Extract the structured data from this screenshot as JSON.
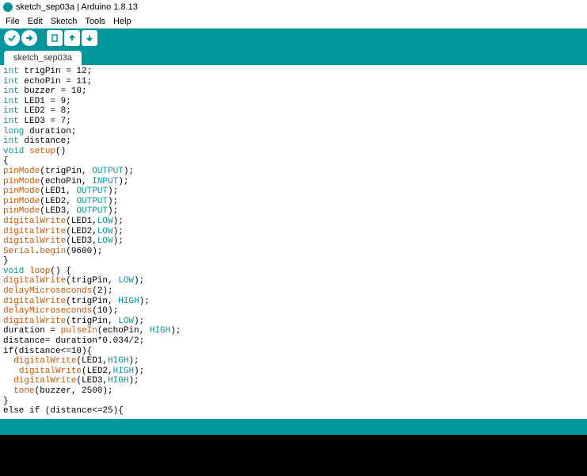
{
  "titlebar": {
    "text": "sketch_sep03a | Arduino 1.8.13"
  },
  "menubar": {
    "items": [
      "File",
      "Edit",
      "Sketch",
      "Tools",
      "Help"
    ]
  },
  "toolbar": {
    "verify": "✓",
    "upload": "→",
    "new": "🗋",
    "open": "↓",
    "save": "↑"
  },
  "tab": {
    "name": "sketch_sep03a"
  },
  "code": {
    "lines": [
      [
        [
          "kw-type",
          "int"
        ],
        [
          "",
          " trigPin = 12;"
        ]
      ],
      [
        [
          "kw-type",
          "int"
        ],
        [
          "",
          " echoPin = 11;"
        ]
      ],
      [
        [
          "kw-type",
          "int"
        ],
        [
          "",
          " buzzer = 10;"
        ]
      ],
      [
        [
          "kw-type",
          "int"
        ],
        [
          "",
          " LED1 = 9;"
        ]
      ],
      [
        [
          "kw-type",
          "int"
        ],
        [
          "",
          " LED2 = 8;"
        ]
      ],
      [
        [
          "kw-type",
          "int"
        ],
        [
          "",
          " LED3 = 7;"
        ]
      ],
      [
        [
          "kw-long",
          "long"
        ],
        [
          "",
          " duration;"
        ]
      ],
      [
        [
          "kw-type",
          "int"
        ],
        [
          "",
          " distance;"
        ]
      ],
      [
        [
          "kw-void",
          "void"
        ],
        [
          "",
          " "
        ],
        [
          "fn",
          "setup"
        ],
        [
          "",
          "()"
        ]
      ],
      [
        [
          "",
          "{"
        ]
      ],
      [
        [
          "fn",
          "pinMode"
        ],
        [
          "",
          "(trigPin, "
        ],
        [
          "const",
          "OUTPUT"
        ],
        [
          "",
          ");"
        ]
      ],
      [
        [
          "fn",
          "pinMode"
        ],
        [
          "",
          "(echoPin, "
        ],
        [
          "const",
          "INPUT"
        ],
        [
          "",
          ");"
        ]
      ],
      [
        [
          "fn",
          "pinMode"
        ],
        [
          "",
          "(LED1, "
        ],
        [
          "const",
          "OUTPUT"
        ],
        [
          "",
          ");"
        ]
      ],
      [
        [
          "fn",
          "pinMode"
        ],
        [
          "",
          "(LED2, "
        ],
        [
          "const",
          "OUTPUT"
        ],
        [
          "",
          ");"
        ]
      ],
      [
        [
          "fn",
          "pinMode"
        ],
        [
          "",
          "(LED3, "
        ],
        [
          "const",
          "OUTPUT"
        ],
        [
          "",
          ");"
        ]
      ],
      [
        [
          "fn",
          "digitalWrite"
        ],
        [
          "",
          "(LED1,"
        ],
        [
          "const",
          "LOW"
        ],
        [
          "",
          ");"
        ]
      ],
      [
        [
          "fn",
          "digitalWrite"
        ],
        [
          "",
          "(LED2,"
        ],
        [
          "const",
          "LOW"
        ],
        [
          "",
          ");"
        ]
      ],
      [
        [
          "fn",
          "digitalWrite"
        ],
        [
          "",
          "(LED3,"
        ],
        [
          "const",
          "LOW"
        ],
        [
          "",
          ");"
        ]
      ],
      [
        [
          "obj",
          "Serial"
        ],
        [
          "",
          "."
        ],
        [
          "method",
          "begin"
        ],
        [
          "",
          "(9600);"
        ]
      ],
      [
        [
          "",
          "}"
        ]
      ],
      [
        [
          "kw-void",
          "void"
        ],
        [
          "",
          " "
        ],
        [
          "fn",
          "loop"
        ],
        [
          "",
          "() {"
        ]
      ],
      [
        [
          "fn",
          "digitalWrite"
        ],
        [
          "",
          "(trigPin, "
        ],
        [
          "const",
          "LOW"
        ],
        [
          "",
          ");"
        ]
      ],
      [
        [
          "fn",
          "delayMicroseconds"
        ],
        [
          "",
          "(2);"
        ]
      ],
      [
        [
          "fn",
          "digitalWrite"
        ],
        [
          "",
          "(trigPin, "
        ],
        [
          "const",
          "HIGH"
        ],
        [
          "",
          ");"
        ]
      ],
      [
        [
          "fn",
          "delayMicroseconds"
        ],
        [
          "",
          "(10);"
        ]
      ],
      [
        [
          "fn",
          "digitalWrite"
        ],
        [
          "",
          "(trigPin, "
        ],
        [
          "const",
          "LOW"
        ],
        [
          "",
          ");"
        ]
      ],
      [
        [
          "",
          "duration = "
        ],
        [
          "fn",
          "pulseIn"
        ],
        [
          "",
          "(echoPin, "
        ],
        [
          "const",
          "HIGH"
        ],
        [
          "",
          ");"
        ]
      ],
      [
        [
          "",
          "distance= duration*0.034/2;"
        ]
      ],
      [
        [
          "",
          "if(distance<=10){"
        ]
      ],
      [
        [
          "",
          "  "
        ],
        [
          "fn",
          "digitalWrite"
        ],
        [
          "",
          "(LED1,"
        ],
        [
          "const",
          "HIGH"
        ],
        [
          "",
          ");"
        ]
      ],
      [
        [
          "",
          "   "
        ],
        [
          "fn",
          "digitalWrite"
        ],
        [
          "",
          "(LED2,"
        ],
        [
          "const",
          "HIGH"
        ],
        [
          "",
          ");"
        ]
      ],
      [
        [
          "",
          "  "
        ],
        [
          "fn",
          "digitalWrite"
        ],
        [
          "",
          "(LED3,"
        ],
        [
          "const",
          "HIGH"
        ],
        [
          "",
          ");"
        ]
      ],
      [
        [
          "",
          "  "
        ],
        [
          "fn",
          "tone"
        ],
        [
          "",
          "(buzzer, 2500);"
        ]
      ],
      [
        [
          "",
          "}"
        ]
      ],
      [
        [
          "",
          "else if (distance<=25){"
        ]
      ]
    ]
  }
}
